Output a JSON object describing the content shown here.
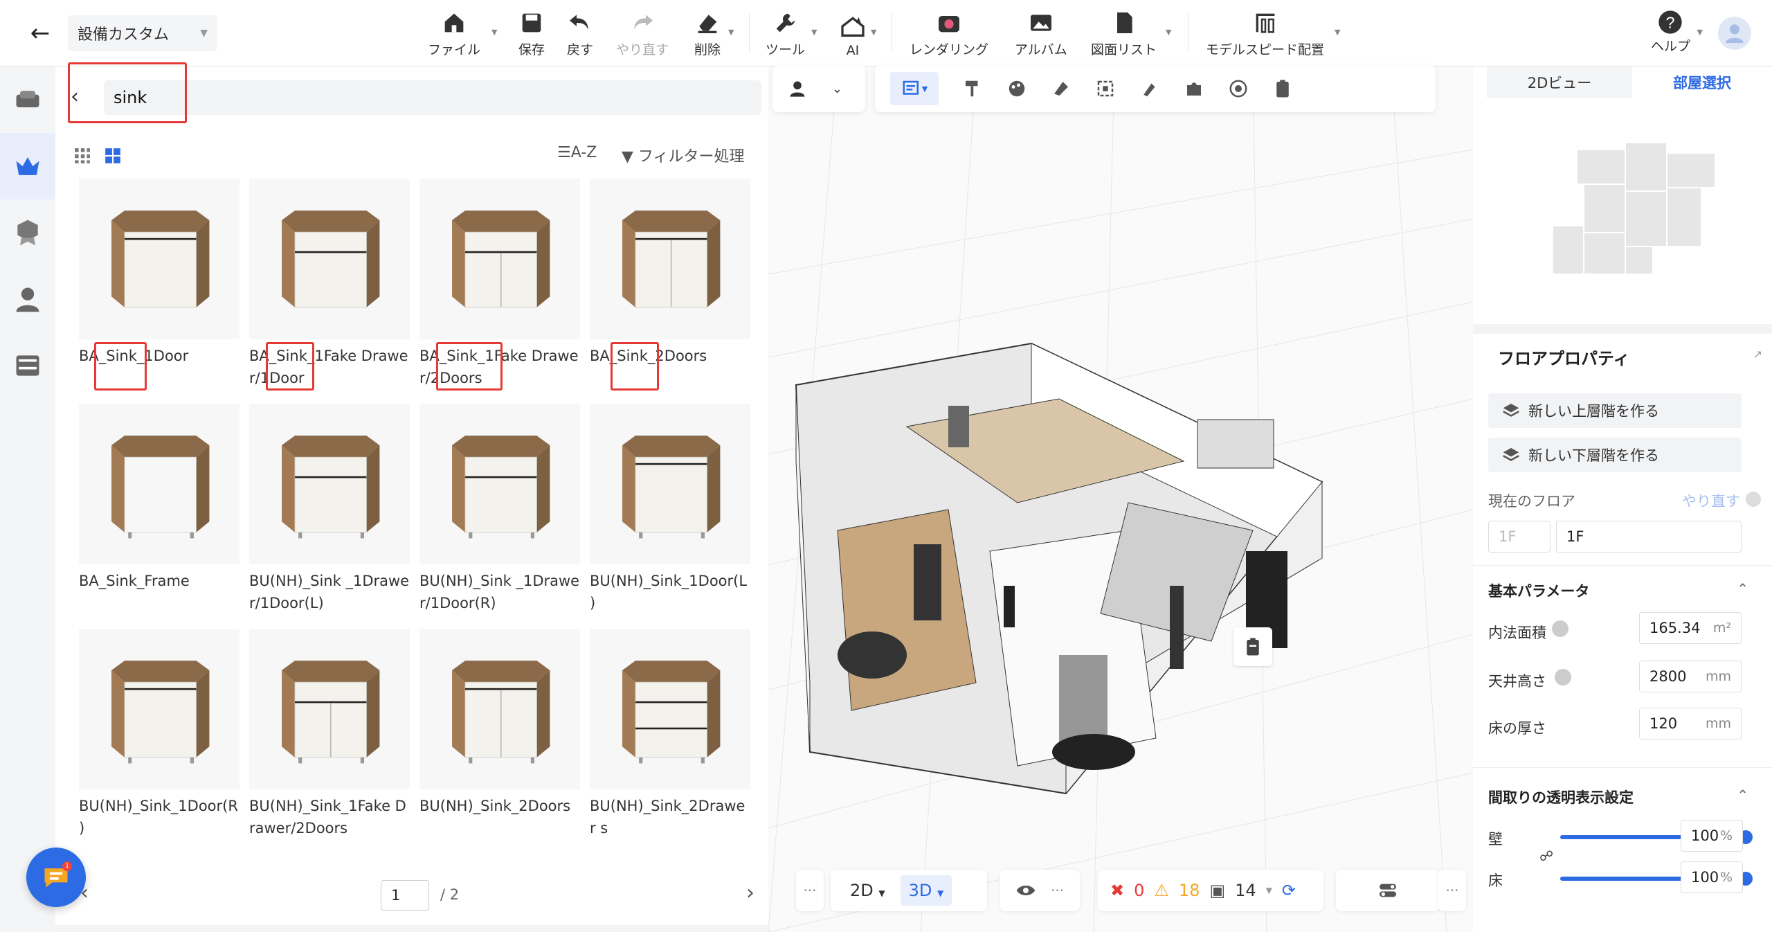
{
  "topbar": {
    "scheme_name": "設備カスタム",
    "items": [
      {
        "label": "ファイル",
        "icon": "home-icon",
        "disabled": false
      },
      {
        "label": "保存",
        "icon": "save-icon",
        "disabled": false
      },
      {
        "label": "戻す",
        "icon": "undo-icon",
        "disabled": false
      },
      {
        "label": "やり直す",
        "icon": "redo-icon",
        "disabled": true
      },
      {
        "label": "削除",
        "icon": "eraser-icon",
        "disabled": false
      },
      {
        "label": "ツール",
        "icon": "wrench-icon",
        "disabled": false
      },
      {
        "label": "AI",
        "icon": "ai-icon",
        "disabled": false
      },
      {
        "label": "レンダリング",
        "icon": "camera-icon",
        "disabled": false
      },
      {
        "label": "アルバム",
        "icon": "album-icon",
        "disabled": false
      },
      {
        "label": "図面リスト",
        "icon": "document-icon",
        "disabled": false
      },
      {
        "label": "モデルスピード配置",
        "icon": "speed-layout-icon",
        "disabled": false
      }
    ],
    "help_label": "ヘルプ"
  },
  "catalog": {
    "search_value": "sink",
    "sort_label": "A-Z",
    "filter_label": "フィルター処理",
    "products": [
      "BA_Sink_1Door",
      "BA_Sink_1Fake Drawer/1Door",
      "BA_Sink_1Fake Drawer/2Doors",
      "BA_Sink_2Doors",
      "BA_Sink_Frame",
      "BU(NH)_Sink _1Drawer/1Door(L)",
      "BU(NH)_Sink _1Drawer/1Door(R)",
      "BU(NH)_Sink_1Door(L )",
      "BU(NH)_Sink_1Door(R )",
      "BU(NH)_Sink_1Fake Drawer/2Doors",
      "BU(NH)_Sink_2Doors",
      "BU(NH)_Sink_2Drawer s"
    ],
    "page_current": "1",
    "page_total": "/ 2"
  },
  "right_panel": {
    "tab_2d": "2Dビュー",
    "tab_room": "部屋選択",
    "title": "フロアプロパティ",
    "new_upper": "新しい上層階を作る",
    "new_lower": "新しい下層階を作る",
    "current_floor_label": "現在のフロア",
    "redo_label": "やり直す",
    "floor_code": "1F",
    "floor_value": "1F",
    "basic_params": "基本パラメータ",
    "area_label": "内法面積",
    "area_value": "165.34",
    "area_unit": "m²",
    "ceiling_label": "天井高さ",
    "ceiling_value": "2800",
    "ceiling_unit": "mm",
    "floor_thickness_label": "床の厚さ",
    "floor_thickness_value": "120",
    "floor_thickness_unit": "mm",
    "transparency_title": "間取りの透明表示設定",
    "wall_label": "壁",
    "wall_value": "100",
    "floor_label": "床",
    "floor_opacity_value": "100",
    "percent": "%"
  },
  "bottom": {
    "view_2d": "2D",
    "view_3d": "3D",
    "errors": "0",
    "warnings": "18",
    "items_count": "14"
  },
  "colors": {
    "accent": "#2d6be4",
    "highlight_red": "#e53935",
    "error": "#e53935",
    "warning": "#f5a623"
  }
}
